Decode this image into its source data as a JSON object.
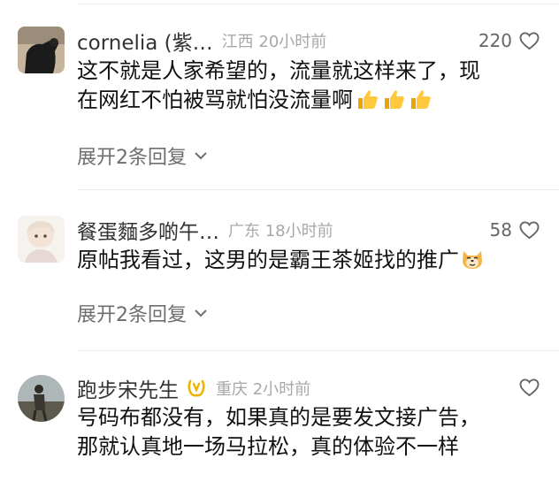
{
  "comments": [
    {
      "username": "cornelia (紫…",
      "location_time": "江西 20小时前",
      "likes": "220",
      "line1": "这不就是人家希望的，流量就这样来了，现",
      "line2": "在网红不怕被骂就怕没流量啊",
      "emoji": "thumbs-up-emoji",
      "replies": "展开2条回复"
    },
    {
      "username": "餐蛋麵多啲午…",
      "location_time": "广东 18小时前",
      "likes": "58",
      "line1": "原帖我看过，这男的是霸王茶姬找的推广",
      "emoji": "dog-face-emoji",
      "replies": "展开2条回复"
    },
    {
      "username": "跑步宋先生",
      "location_time": "重庆 2小时前",
      "badge": "yellow-laurel-badge-icon",
      "line1": "号码布都没有，如果真的是要发文接广告，",
      "line2": "那就认真地一场马拉松，真的体验不一样"
    }
  ]
}
